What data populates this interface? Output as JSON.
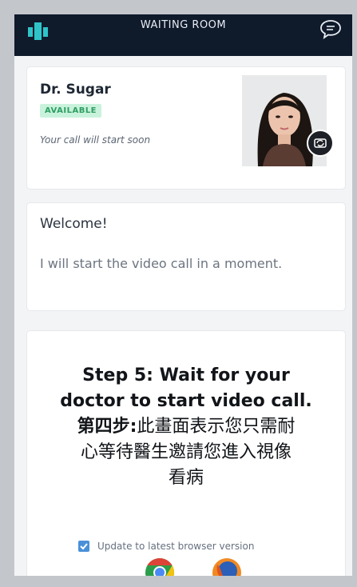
{
  "header": {
    "title": "WAITING ROOM",
    "logo_icon": "brand-logo-icon",
    "chat_icon": "chat-bubble-icon",
    "background_color": "#0f1a2b",
    "accent_color": "#2ec4c8"
  },
  "doctor": {
    "name": "Dr. Sugar",
    "status_badge": "AVAILABLE",
    "status_text": "Your call will start soon",
    "badge_color": "#2e9e62",
    "switch_camera_icon": "switch-camera-icon"
  },
  "welcome": {
    "title": "Welcome!",
    "message": "I will start the video call in a moment."
  },
  "step": {
    "line1": "Step 5: Wait for your",
    "line2": "doctor to start video call.",
    "zh_bold": "第四步:",
    "zh_line1": "此畫面表示您只需耐",
    "zh_line2": "心等待醫生邀請您進入視像",
    "zh_line3": "看病"
  },
  "browser": {
    "update_label": "Update to latest browser version",
    "checkbox_checked": true,
    "icons": [
      "chrome-icon",
      "firefox-icon"
    ]
  }
}
